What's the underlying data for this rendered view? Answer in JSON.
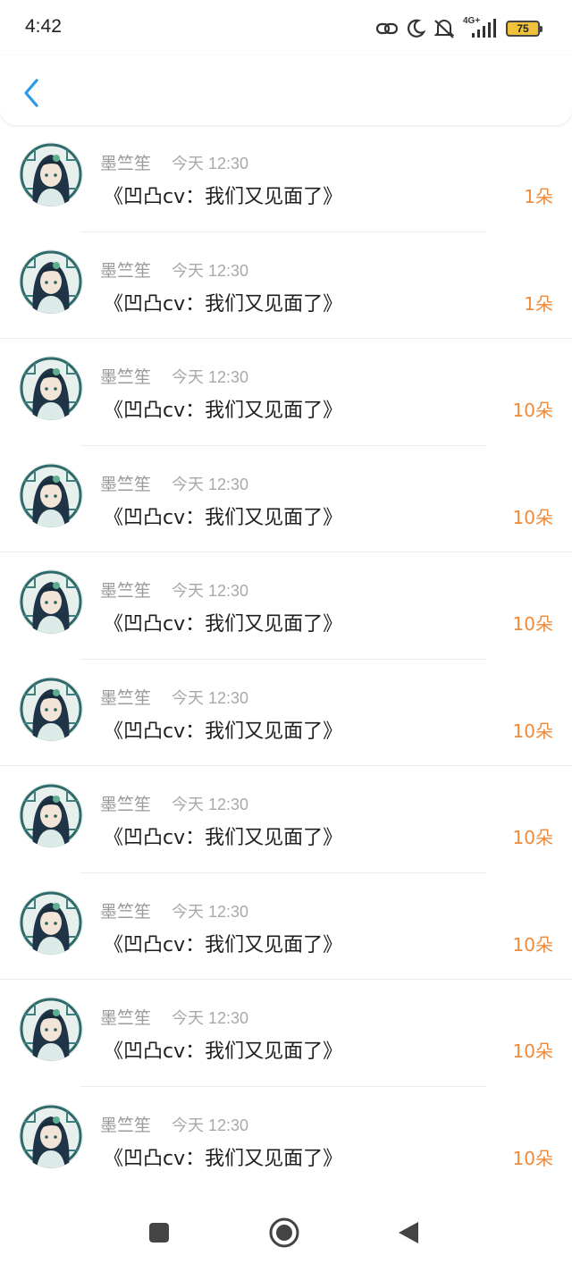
{
  "status_bar": {
    "time": "4:42",
    "battery": "75",
    "network": "4G+",
    "icons": [
      "link-icon",
      "moon-icon",
      "mute-icon",
      "signal-icon",
      "battery-icon"
    ]
  },
  "header": {
    "back_icon": "chevron-left-icon",
    "accent": "#2a9ae6"
  },
  "colors": {
    "amount": "#ef8a3a",
    "meta": "#9a9a9a"
  },
  "items": [
    {
      "name": "墨竺笙",
      "time": "今天 12:30",
      "title": "《凹凸cv：我们又见面了》",
      "amount": "1朵"
    },
    {
      "name": "墨竺笙",
      "time": "今天 12:30",
      "title": "《凹凸cv：我们又见面了》",
      "amount": "1朵"
    },
    {
      "name": "墨竺笙",
      "time": "今天 12:30",
      "title": "《凹凸cv：我们又见面了》",
      "amount": "10朵"
    },
    {
      "name": "墨竺笙",
      "time": "今天 12:30",
      "title": "《凹凸cv：我们又见面了》",
      "amount": "10朵"
    },
    {
      "name": "墨竺笙",
      "time": "今天 12:30",
      "title": "《凹凸cv：我们又见面了》",
      "amount": "10朵"
    },
    {
      "name": "墨竺笙",
      "time": "今天 12:30",
      "title": "《凹凸cv：我们又见面了》",
      "amount": "10朵"
    },
    {
      "name": "墨竺笙",
      "time": "今天 12:30",
      "title": "《凹凸cv：我们又见面了》",
      "amount": "10朵"
    },
    {
      "name": "墨竺笙",
      "time": "今天 12:30",
      "title": "《凹凸cv：我们又见面了》",
      "amount": "10朵"
    },
    {
      "name": "墨竺笙",
      "time": "今天 12:30",
      "title": "《凹凸cv：我们又见面了》",
      "amount": "10朵"
    },
    {
      "name": "墨竺笙",
      "time": "今天 12:30",
      "title": "《凹凸cv：我们又见面了》",
      "amount": "10朵"
    }
  ],
  "nav": [
    "recent-apps-icon",
    "home-icon",
    "back-triangle-icon"
  ]
}
